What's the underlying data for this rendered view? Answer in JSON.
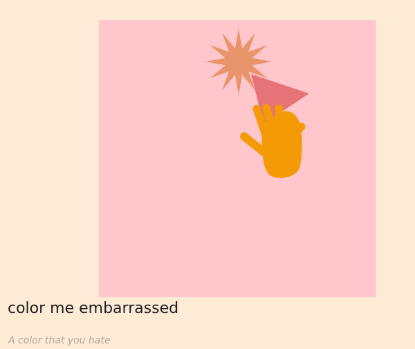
{
  "colors": {
    "page_background": "#fdebd6",
    "art_background": "#ffc6cc",
    "sparkle": "#e9956b",
    "triangle": "#e57377",
    "hand": "#f39a06",
    "title_text": "#1f1f1f",
    "subtitle_text": "#b4a89b"
  },
  "artwork": {
    "icons": [
      "sparkle-star-icon",
      "triangle-icon",
      "waving-hand-icon"
    ]
  },
  "caption": {
    "title": "color me embarrassed",
    "subtitle": "A color that you hate"
  }
}
